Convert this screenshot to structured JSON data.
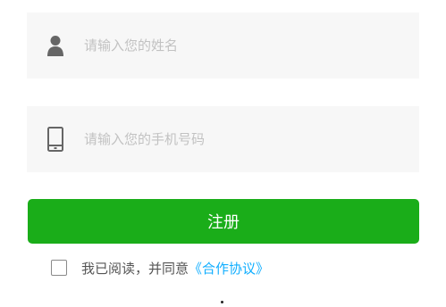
{
  "form": {
    "name_field": {
      "placeholder": "请输入您的姓名",
      "value": "",
      "icon": "user-icon"
    },
    "phone_field": {
      "placeholder": "请输入您的手机号码",
      "value": "",
      "icon": "mobile-phone-icon"
    },
    "register_button": {
      "label": "注册"
    },
    "agreement": {
      "checked": false,
      "text": "我已阅读，并同意",
      "link_text": "《合作协议》"
    }
  },
  "colors": {
    "primary_green": "#1aad19",
    "link_blue": "#10aeff",
    "field_background": "#f7f7f7",
    "placeholder_gray": "#c2c2c2"
  }
}
